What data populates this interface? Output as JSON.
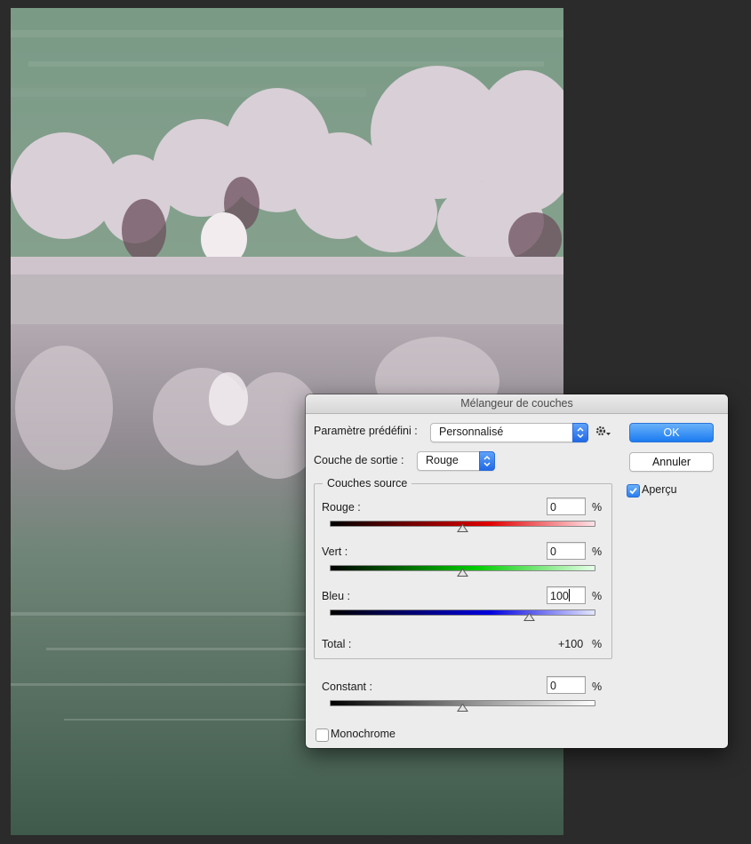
{
  "dialog": {
    "title": "Mélangeur de couches",
    "preset_label": "Paramètre prédéfini :",
    "preset_value": "Personnalisé",
    "output_label": "Couche de sortie :",
    "output_value": "Rouge",
    "ok_label": "OK",
    "cancel_label": "Annuler",
    "preview_label": "Aperçu",
    "preview_checked": true,
    "source_group_label": "Couches source",
    "channels": [
      {
        "label": "Rouge :",
        "value": "0",
        "unit": "%",
        "slider": 0,
        "color": "#e00000"
      },
      {
        "label": "Vert :",
        "value": "0",
        "unit": "%",
        "slider": 0,
        "color": "#00cc00"
      },
      {
        "label": "Bleu :",
        "value": "100",
        "unit": "%",
        "slider": 100,
        "color": "#0000dd"
      }
    ],
    "total_label": "Total :",
    "total_value": "+100",
    "total_unit": "%",
    "constant_label": "Constant :",
    "constant_value": "0",
    "constant_unit": "%",
    "monochrome_label": "Monochrome",
    "monochrome_checked": false
  },
  "icons": {
    "preset_gear": "gear-icon",
    "popup_arrows": "updown-chevron-icon"
  },
  "colors": {
    "accent": "#2a7ef0",
    "dialog_bg": "#ececec",
    "workspace_bg": "#2b2b2b"
  }
}
